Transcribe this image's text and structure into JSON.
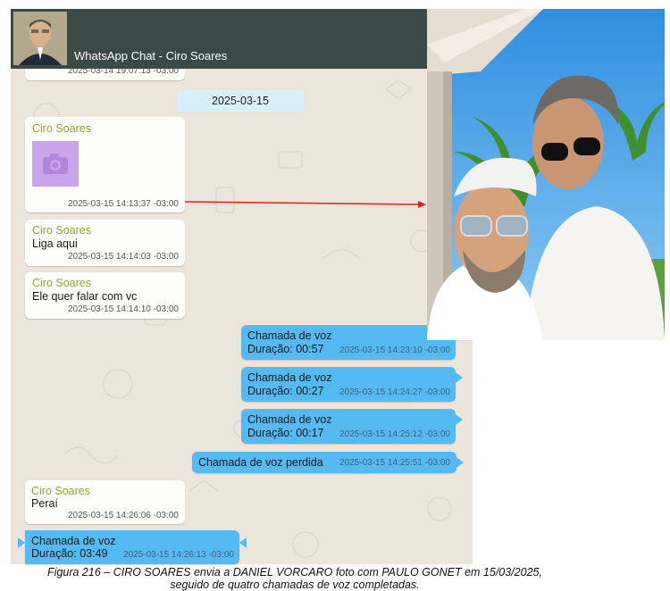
{
  "header": {
    "title": "WhatsApp Chat - Ciro Soares"
  },
  "date_separator": "2025-03-15",
  "partial_timestamp": "2025-03-14 19:07:13 -03:00",
  "messages": [
    {
      "type": "photo",
      "direction": "in",
      "sender": "Ciro Soares",
      "timestamp": "2025-03-15 14:13:37 -03:00"
    },
    {
      "type": "text",
      "direction": "in",
      "sender": "Ciro Soares",
      "text": "Liga aqui",
      "timestamp": "2025-03-15 14:14:03 -03:00"
    },
    {
      "type": "text",
      "direction": "in",
      "sender": "Ciro Soares",
      "text": "Ele quer falar com vc",
      "timestamp": "2025-03-15 14:14:10 -03:00"
    },
    {
      "type": "call",
      "direction": "out",
      "line1": "Chamada de voz",
      "line2": "Duração: 00:57",
      "timestamp": "2025-03-15 14:23:10 -03:00"
    },
    {
      "type": "call",
      "direction": "out",
      "line1": "Chamada de voz",
      "line2": "Duração: 00:27",
      "timestamp": "2025-03-15 14:24:27 -03:00"
    },
    {
      "type": "call",
      "direction": "out",
      "line1": "Chamada de voz",
      "line2": "Duração: 00:17",
      "timestamp": "2025-03-15 14:25:12 -03:00"
    },
    {
      "type": "missed",
      "direction": "out",
      "text": "Chamada de voz perdida",
      "timestamp": "2025-03-15 14:25:51 -03:00"
    },
    {
      "type": "text",
      "direction": "in",
      "sender": "Ciro Soares",
      "text": "Peraí",
      "timestamp": "2025-03-15 14:26:06 -03:00"
    },
    {
      "type": "call",
      "direction": "in",
      "line1": "Chamada de voz",
      "line2": "Duração: 03:49",
      "timestamp": "2025-03-15 14:26:13 -03:00"
    }
  ],
  "caption": {
    "line1": "Figura 216 – CIRO SOARES envia a DANIEL VORCARO foto com PAULO GONET em 15/03/2025,",
    "line2": "seguido de quatro chamadas de voz completadas."
  },
  "colors": {
    "header_bg": "#3c4a47",
    "outgoing_bubble": "#55b9f2",
    "incoming_bubble": "#fdfdfa",
    "sender_name": "#8ea634",
    "arrow": "#e02020"
  }
}
